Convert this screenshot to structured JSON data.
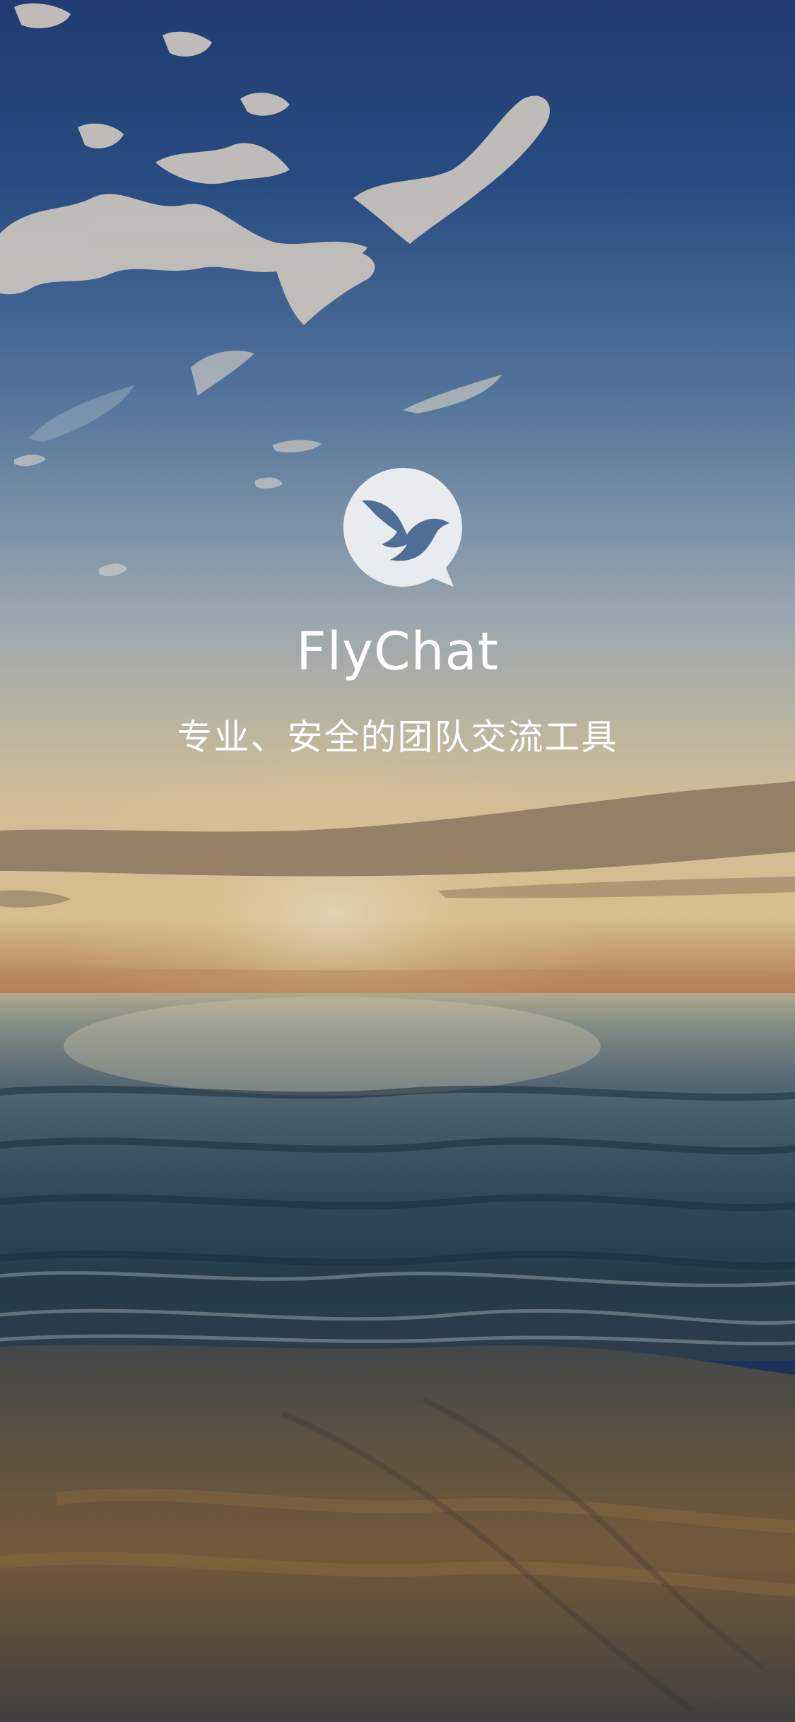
{
  "app": {
    "name": "FlyChat",
    "tagline": "专业、安全的团队交流工具"
  },
  "icons": {
    "logo": "bird-chat-bubble-icon"
  },
  "colors": {
    "sky_top": "#244a86",
    "sky_mid": "#4f78a8",
    "horizon_glow": "#f3d9a6",
    "sea": "#3b5a72",
    "sand": "#6a5a44",
    "logo_bubble": "#e9ecef",
    "logo_bird": "#4f6f96",
    "text": "#ffffff"
  }
}
